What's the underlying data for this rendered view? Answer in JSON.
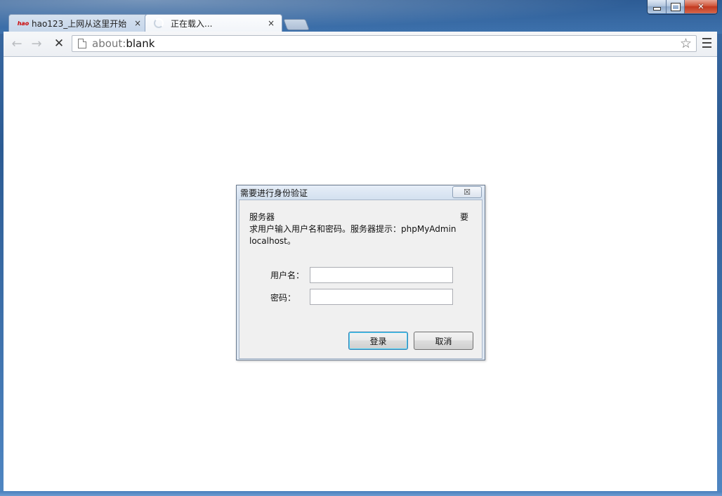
{
  "window": {
    "controls": {
      "minimize": "minimize",
      "maximize": "maximize",
      "close": "close"
    }
  },
  "tabs": [
    {
      "title": "hao123_上网从这里开始",
      "favicon": "hao",
      "close": "×",
      "active": false
    },
    {
      "title": "正在载入...",
      "close": "×",
      "active": true
    }
  ],
  "toolbar": {
    "back_icon": "←",
    "forward_icon": "→",
    "stop_icon": "✕",
    "url_scheme": "about:",
    "url_host": "blank",
    "star_icon": "☆"
  },
  "dialog": {
    "title": "需要进行身份验证",
    "close_icon": "☒",
    "message_line1_left": "服务器",
    "message_line1_right": "要",
    "message_line2": "求用户输入用户名和密码。服务器提示：phpMyAdmin",
    "message_line3": "localhost。",
    "username_label": "用户名：",
    "password_label": "密码：",
    "username_value": "",
    "password_value": "",
    "login_button": "登录",
    "cancel_button": "取消"
  },
  "colors": {
    "accent": "#3c7fb1",
    "frame": "#2c5b93",
    "close_red": "#c2381f"
  }
}
